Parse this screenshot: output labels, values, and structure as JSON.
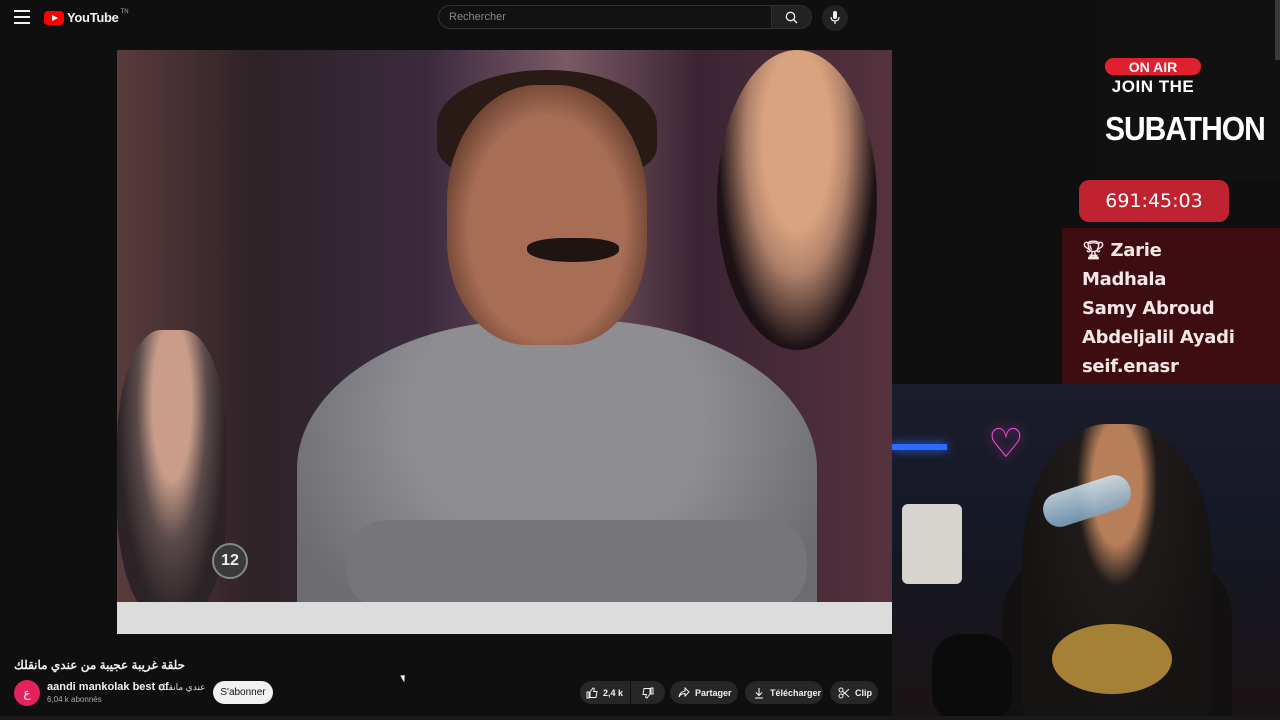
{
  "header": {
    "logo_text": "YouTube",
    "logo_country": "TN",
    "search_placeholder": "Rechercher",
    "icons": {
      "menu": "hamburger-icon",
      "search": "search-icon",
      "mic": "mic-icon",
      "avatar": "avatar"
    }
  },
  "player": {
    "channel_bug": "12"
  },
  "stream_overlay": {
    "on_air": "ON AIR",
    "join": "JOIN THE",
    "subathon": "SUBATHON",
    "timer": "691:45:03",
    "supporters": [
      "Zarie",
      "Madhala",
      "Samy Abroud",
      "Abdeljalil Ayadi",
      "seif.enasr"
    ],
    "top_icon": "trophy-icon"
  },
  "video": {
    "title": "حلقة غريبة عجيبة من عندي مانقلك",
    "channel_initial": "ع",
    "channel_name": "aandi mankolak best of",
    "channel_name_ar": "عندي مانقلك",
    "subscribers": "6,04 k abonnés",
    "subscribe_label": "S'abonner"
  },
  "actions": {
    "likes": "2,4 k",
    "share": "Partager",
    "download": "Télécharger",
    "clip": "Clip"
  },
  "colors": {
    "brand_red": "#ff0000",
    "overlay_red": "#c1222f",
    "background": "#0f0f0f"
  }
}
